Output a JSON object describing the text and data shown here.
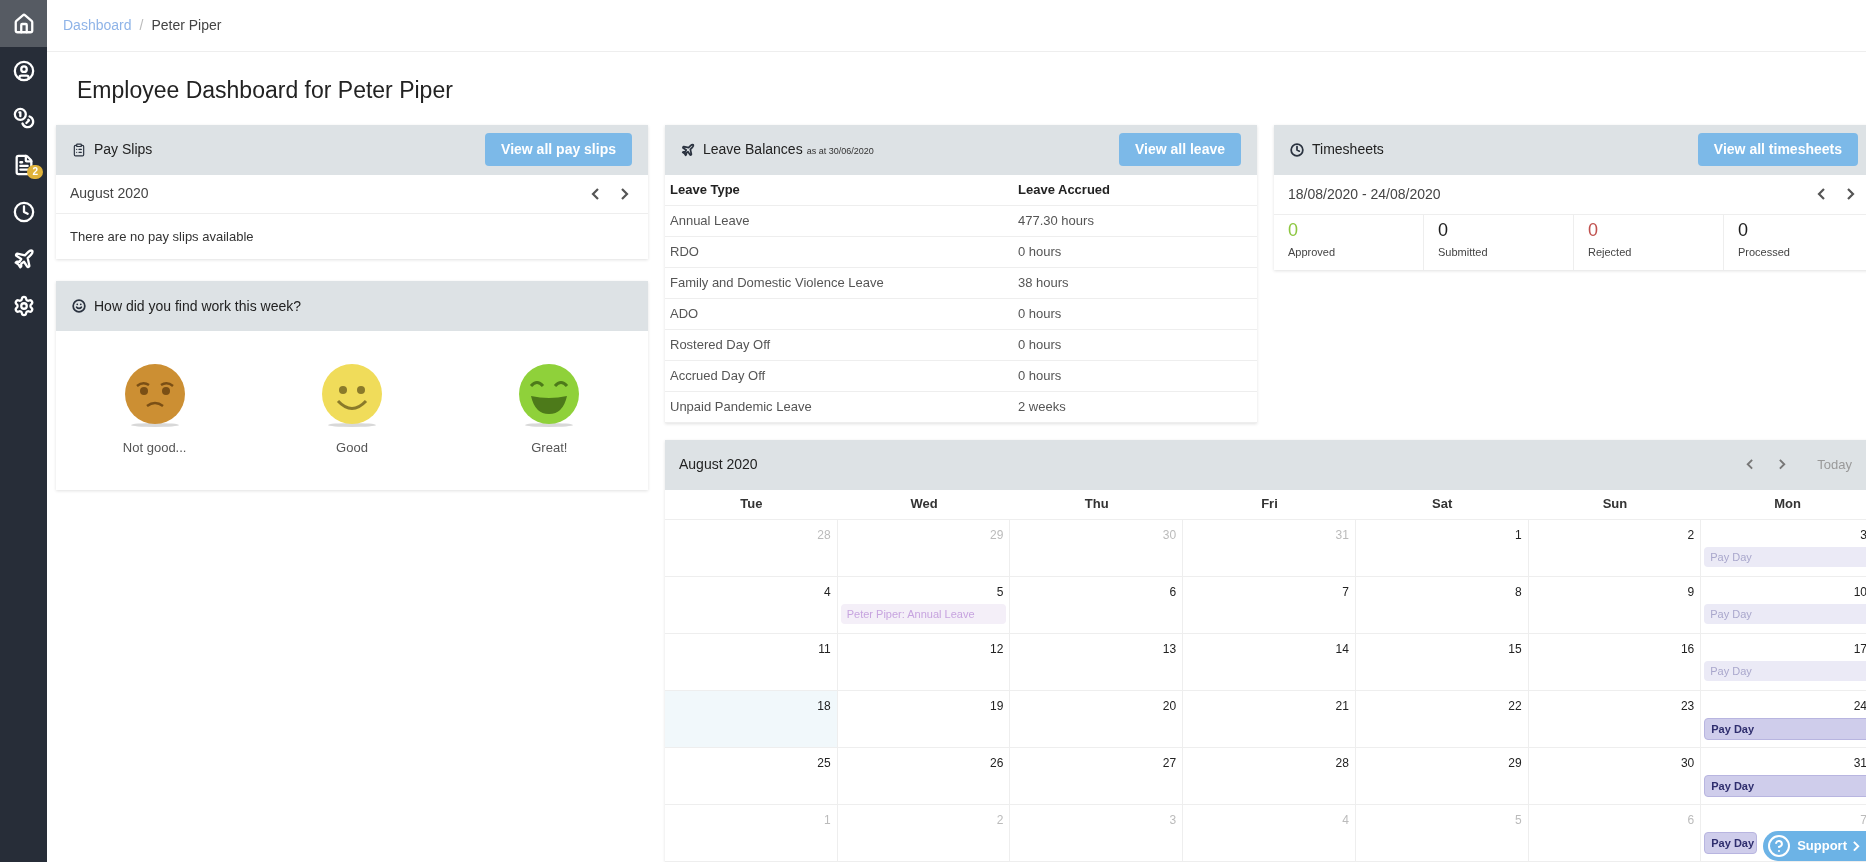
{
  "sidebar": {
    "items": [
      {
        "selected": true
      },
      {
        "selected": false
      },
      {
        "selected": false
      },
      {
        "selected": false,
        "badge": "2"
      },
      {
        "selected": false
      },
      {
        "selected": false
      },
      {
        "selected": false
      }
    ]
  },
  "breadcrumb": {
    "separator": "/",
    "items": [
      {
        "label": "Dashboard",
        "current": false
      },
      {
        "label": "Peter Piper",
        "current": true
      }
    ]
  },
  "title": "Employee Dashboard for Peter Piper",
  "pay_slips": {
    "title": "Pay Slips",
    "button": "View all pay slips",
    "period": "August 2020",
    "message": "There are no pay slips available"
  },
  "mood": {
    "title": "How did you find work this week?",
    "options": [
      {
        "kind": "sad",
        "label": "Not good..."
      },
      {
        "kind": "smile",
        "label": "Good"
      },
      {
        "kind": "grin",
        "label": "Great!"
      }
    ]
  },
  "leave": {
    "title": "Leave Balances",
    "subtitle": "as at 30/06/2020",
    "button": "View all leave",
    "columns": [
      "Leave Type",
      "Leave Accrued"
    ],
    "rows": [
      [
        "Annual Leave",
        "477.30 hours"
      ],
      [
        "RDO",
        "0 hours"
      ],
      [
        "Family and Domestic Violence Leave",
        "38 hours"
      ],
      [
        "ADO",
        "0 hours"
      ],
      [
        "Rostered Day Off",
        "0 hours"
      ],
      [
        "Accrued Day Off",
        "0 hours"
      ],
      [
        "Unpaid Pandemic Leave",
        "2 weeks"
      ]
    ]
  },
  "timesheets": {
    "title": "Timesheets",
    "button": "View all timesheets",
    "period": "18/08/2020 - 24/08/2020",
    "stats": [
      {
        "value": "0",
        "label": "Approved",
        "color": "#8cc63f"
      },
      {
        "value": "0",
        "label": "Submitted",
        "color": "#1c1c1c"
      },
      {
        "value": "0",
        "label": "Rejected",
        "color": "#c0504d"
      },
      {
        "value": "0",
        "label": "Processed",
        "color": "#1c1c1c"
      }
    ]
  },
  "calendar": {
    "title": "August 2020",
    "today_button": "Today",
    "weekdays": [
      "Tue",
      "Wed",
      "Thu",
      "Fri",
      "Sat",
      "Sun",
      "Mon"
    ],
    "weeks": [
      [
        {
          "day": "28",
          "muted": true,
          "today": false
        },
        {
          "day": "29",
          "muted": true,
          "today": false
        },
        {
          "day": "30",
          "muted": true,
          "today": false
        },
        {
          "day": "31",
          "muted": true,
          "today": false
        },
        {
          "day": "1",
          "muted": false,
          "today": false
        },
        {
          "day": "2",
          "muted": false,
          "today": false
        },
        {
          "day": "3",
          "muted": false,
          "today": false,
          "events": [
            {
              "kind": "payday",
              "label": "Pay Day",
              "faded": true
            }
          ]
        }
      ],
      [
        {
          "day": "4",
          "muted": false,
          "today": false
        },
        {
          "day": "5",
          "muted": false,
          "today": false,
          "events": [
            {
              "kind": "leave",
              "label": "Peter Piper: Annual Leave",
              "faded": true
            }
          ]
        },
        {
          "day": "6",
          "muted": false,
          "today": false
        },
        {
          "day": "7",
          "muted": false,
          "today": false
        },
        {
          "day": "8",
          "muted": false,
          "today": false
        },
        {
          "day": "9",
          "muted": false,
          "today": false
        },
        {
          "day": "10",
          "muted": false,
          "today": false,
          "events": [
            {
              "kind": "payday",
              "label": "Pay Day",
              "faded": true
            }
          ]
        }
      ],
      [
        {
          "day": "11",
          "muted": false,
          "today": false
        },
        {
          "day": "12",
          "muted": false,
          "today": false
        },
        {
          "day": "13",
          "muted": false,
          "today": false
        },
        {
          "day": "14",
          "muted": false,
          "today": false
        },
        {
          "day": "15",
          "muted": false,
          "today": false
        },
        {
          "day": "16",
          "muted": false,
          "today": false
        },
        {
          "day": "17",
          "muted": false,
          "today": false,
          "events": [
            {
              "kind": "payday",
              "label": "Pay Day",
              "faded": true
            }
          ]
        }
      ],
      [
        {
          "day": "18",
          "muted": false,
          "today": true
        },
        {
          "day": "19",
          "muted": false,
          "today": false
        },
        {
          "day": "20",
          "muted": false,
          "today": false
        },
        {
          "day": "21",
          "muted": false,
          "today": false
        },
        {
          "day": "22",
          "muted": false,
          "today": false
        },
        {
          "day": "23",
          "muted": false,
          "today": false
        },
        {
          "day": "24",
          "muted": false,
          "today": false,
          "events": [
            {
              "kind": "payday",
              "label": "Pay Day",
              "faded": false
            }
          ]
        }
      ],
      [
        {
          "day": "25",
          "muted": false,
          "today": false
        },
        {
          "day": "26",
          "muted": false,
          "today": false
        },
        {
          "day": "27",
          "muted": false,
          "today": false
        },
        {
          "day": "28",
          "muted": false,
          "today": false
        },
        {
          "day": "29",
          "muted": false,
          "today": false
        },
        {
          "day": "30",
          "muted": false,
          "today": false
        },
        {
          "day": "31",
          "muted": false,
          "today": false,
          "events": [
            {
              "kind": "payday",
              "label": "Pay Day",
              "faded": false
            }
          ]
        }
      ],
      [
        {
          "day": "1",
          "muted": true,
          "today": false
        },
        {
          "day": "2",
          "muted": true,
          "today": false
        },
        {
          "day": "3",
          "muted": true,
          "today": false
        },
        {
          "day": "4",
          "muted": true,
          "today": false
        },
        {
          "day": "5",
          "muted": true,
          "today": false
        },
        {
          "day": "6",
          "muted": true,
          "today": false
        },
        {
          "day": "7",
          "muted": true,
          "today": false,
          "events": [
            {
              "kind": "payday",
              "label": "Pay Day",
              "faded": false
            }
          ]
        }
      ]
    ]
  },
  "support": {
    "label": "Support"
  }
}
